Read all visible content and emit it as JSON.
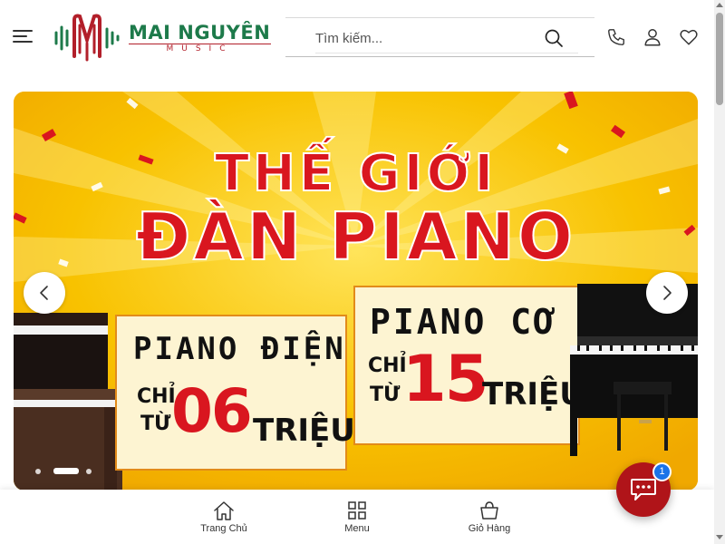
{
  "header": {
    "logo_name": "MAI NGUYÊN",
    "logo_sub": "MUSIC",
    "search_placeholder": "Tìm kiếm...",
    "icons": [
      "menu-icon",
      "search-icon",
      "phone-icon",
      "user-icon",
      "heart-icon"
    ]
  },
  "banner": {
    "title_line1": "THẾ GIỚI",
    "title_line2": "ĐÀN PIANO",
    "left_panel": {
      "heading": "PIANO ĐIỆN",
      "chi": "CHỈ",
      "tu": "TỪ",
      "price": "06",
      "unit": "TRIỆU"
    },
    "right_panel": {
      "heading": "PIANO CƠ",
      "chi": "CHỈ",
      "tu": "TỪ",
      "price": "15",
      "unit": "TRIỆU"
    },
    "prev_icon": "chevron-left-icon",
    "next_icon": "chevron-right-icon",
    "active_slide": 2,
    "slide_count": 3
  },
  "bottom_nav": {
    "items": [
      {
        "label": "Trang Chủ",
        "icon": "home-icon"
      },
      {
        "label": "Menu",
        "icon": "grid-icon"
      },
      {
        "label": "Giỏ Hàng",
        "icon": "basket-icon"
      }
    ]
  },
  "chat": {
    "badge": "1",
    "icon": "chat-icon"
  },
  "colors": {
    "brand_green": "#1d7a4a",
    "brand_red": "#b21f2a",
    "banner_yellow": "#f6b700",
    "headline_red": "#d9161f",
    "chat_red": "#b01419",
    "badge_blue": "#1a73e8"
  }
}
